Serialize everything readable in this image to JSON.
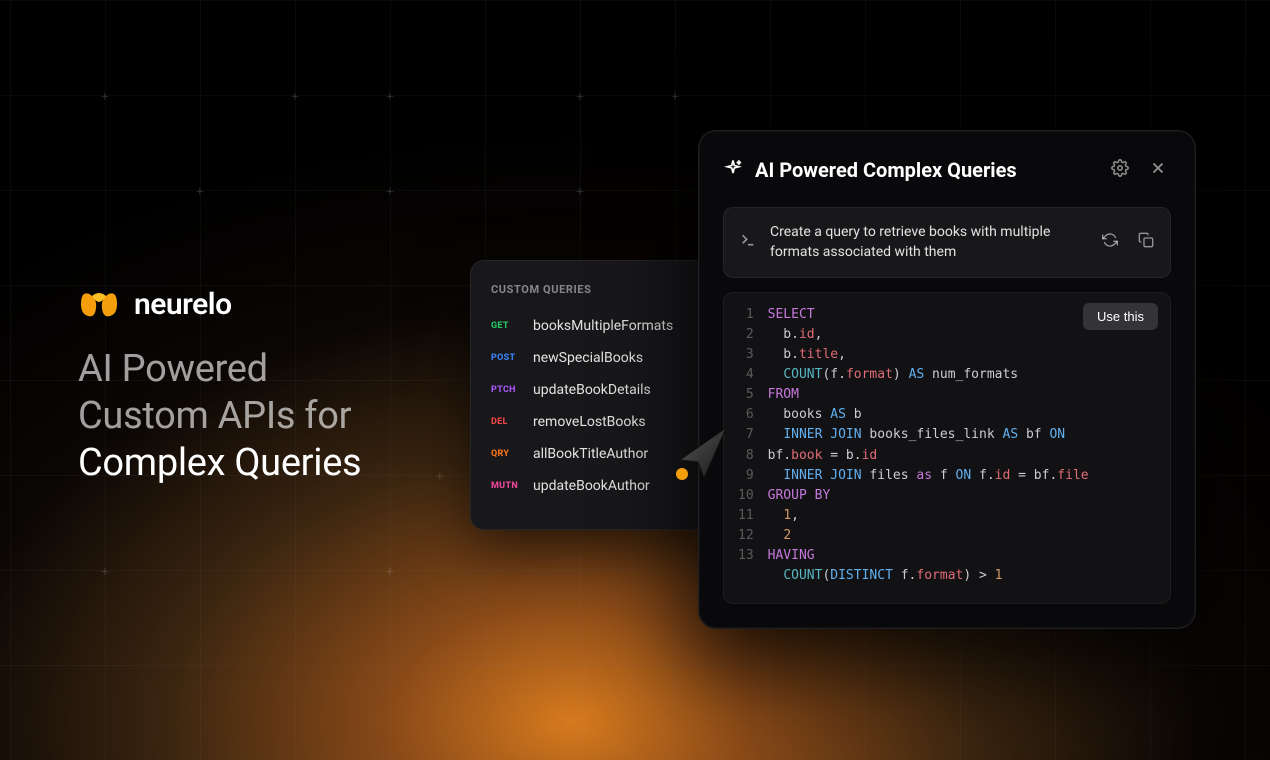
{
  "brand": {
    "name": "neurelo"
  },
  "headline": {
    "line1": "AI Powered",
    "line2": "Custom APIs for",
    "line3": "Complex Queries"
  },
  "queries": {
    "section_title": "CUSTOM QUERIES",
    "items": [
      {
        "method": "GET",
        "method_class": "m-get",
        "name": "booksMultipleFormats"
      },
      {
        "method": "POST",
        "method_class": "m-post",
        "name": "newSpecialBooks"
      },
      {
        "method": "PTCH",
        "method_class": "m-ptch",
        "name": "updateBookDetails"
      },
      {
        "method": "DEL",
        "method_class": "m-del",
        "name": "removeLostBooks"
      },
      {
        "method": "QRY",
        "method_class": "m-qry",
        "name": "allBookTitleAuthor"
      },
      {
        "method": "MUTN",
        "method_class": "m-mutn",
        "name": "updateBookAuthor"
      }
    ]
  },
  "ai_panel": {
    "title": "AI Powered Complex Queries",
    "prompt": "Create a query to retrieve books with multiple formats associated with them",
    "use_button": "Use this",
    "code": {
      "line_count": 13,
      "tokens": [
        [
          {
            "t": "SELECT",
            "c": "kw"
          }
        ],
        [
          {
            "t": "  b.",
            "c": ""
          },
          {
            "t": "id",
            "c": "ident"
          },
          {
            "t": ",",
            "c": ""
          }
        ],
        [
          {
            "t": "  b.",
            "c": ""
          },
          {
            "t": "title",
            "c": "ident"
          },
          {
            "t": ",",
            "c": ""
          }
        ],
        [
          {
            "t": "  ",
            "c": ""
          },
          {
            "t": "COUNT",
            "c": "fn"
          },
          {
            "t": "(f.",
            "c": ""
          },
          {
            "t": "format",
            "c": "ident"
          },
          {
            "t": ") ",
            "c": ""
          },
          {
            "t": "AS",
            "c": "kw2"
          },
          {
            "t": " num_formats",
            "c": ""
          }
        ],
        [
          {
            "t": "FROM",
            "c": "kw"
          }
        ],
        [
          {
            "t": "  books ",
            "c": ""
          },
          {
            "t": "AS",
            "c": "kw2"
          },
          {
            "t": " b",
            "c": ""
          }
        ],
        [
          {
            "t": "  ",
            "c": ""
          },
          {
            "t": "INNER JOIN",
            "c": "kw2"
          },
          {
            "t": " books_files_link ",
            "c": ""
          },
          {
            "t": "AS",
            "c": "kw2"
          },
          {
            "t": " bf ",
            "c": ""
          },
          {
            "t": "ON",
            "c": "kw2"
          }
        ],
        [
          {
            "t": "bf.",
            "c": ""
          },
          {
            "t": "book",
            "c": "ident"
          },
          {
            "t": " = b.",
            "c": ""
          },
          {
            "t": "id",
            "c": "ident"
          }
        ],
        [
          {
            "t": "  ",
            "c": ""
          },
          {
            "t": "INNER JOIN",
            "c": "kw2"
          },
          {
            "t": " files ",
            "c": ""
          },
          {
            "t": "as",
            "c": "kw"
          },
          {
            "t": " f ",
            "c": ""
          },
          {
            "t": "ON",
            "c": "kw2"
          },
          {
            "t": " f.",
            "c": ""
          },
          {
            "t": "id",
            "c": "ident"
          },
          {
            "t": " = bf.",
            "c": ""
          },
          {
            "t": "file",
            "c": "ident"
          }
        ],
        [
          {
            "t": "GROUP BY",
            "c": "kw"
          }
        ],
        [
          {
            "t": "  ",
            "c": ""
          },
          {
            "t": "1",
            "c": "num"
          },
          {
            "t": ",",
            "c": ""
          }
        ],
        [
          {
            "t": "  ",
            "c": ""
          },
          {
            "t": "2",
            "c": "num"
          }
        ],
        [
          {
            "t": "HAVING",
            "c": "kw"
          }
        ],
        [
          {
            "t": "  ",
            "c": ""
          },
          {
            "t": "COUNT",
            "c": "fn"
          },
          {
            "t": "(",
            "c": ""
          },
          {
            "t": "DISTINCT",
            "c": "kw2"
          },
          {
            "t": " f.",
            "c": ""
          },
          {
            "t": "format",
            "c": "ident"
          },
          {
            "t": ") > ",
            "c": ""
          },
          {
            "t": "1",
            "c": "num"
          }
        ]
      ]
    }
  }
}
